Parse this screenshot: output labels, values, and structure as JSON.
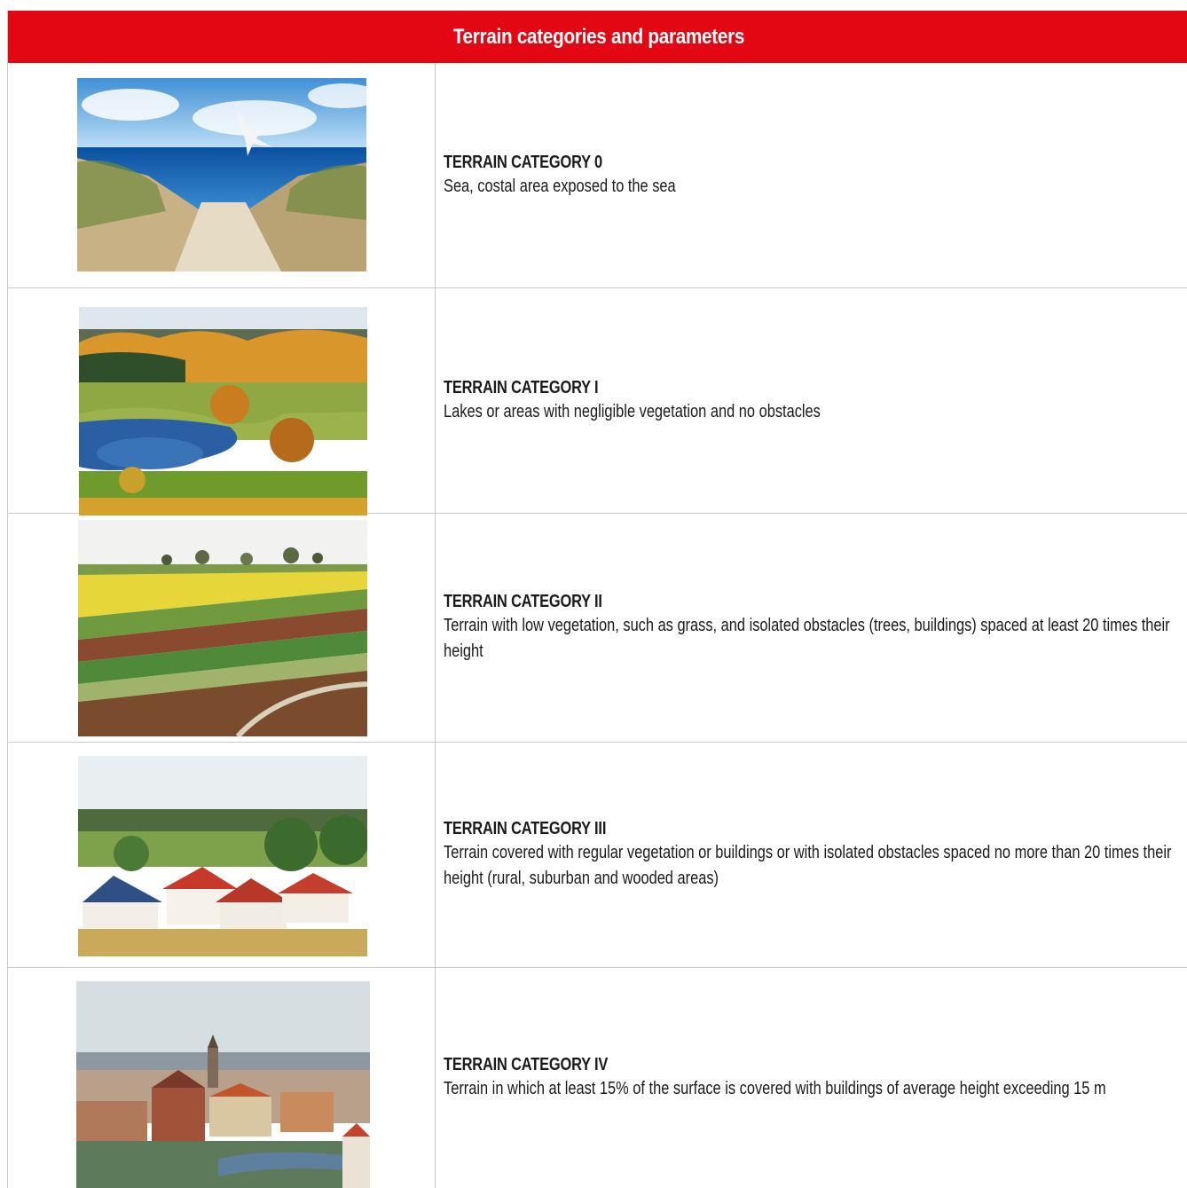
{
  "header": {
    "title": "Terrain categories and parameters"
  },
  "rows": [
    {
      "title": "TERRAIN CATEGORY 0",
      "description": "Sea, costal area exposed to the sea",
      "image": "sea-beach-photo"
    },
    {
      "title": "TERRAIN CATEGORY I",
      "description": "Lakes or areas with negligible vegetation and no obstacles",
      "image": "lake-autumn-photo"
    },
    {
      "title": "TERRAIN CATEGORY II",
      "description": "Terrain with low vegetation, such as grass, and isolated obstacles (trees, buildings) spaced at least 20 times their height",
      "image": "farmland-fields-photo"
    },
    {
      "title": "TERRAIN CATEGORY III",
      "description": "Terrain covered with regular vegetation or buildings or with isolated obstacles spaced no more than 20 times their height (rural, suburban and wooded areas)",
      "image": "suburban-houses-photo"
    },
    {
      "title": "TERRAIN CATEGORY IV",
      "description": "Terrain in which at least 15% of the surface is covered with buildings of average height exceeding 15 m",
      "image": "city-skyline-photo"
    }
  ],
  "colors": {
    "header_bg": "#e30613",
    "header_text": "#ffffff",
    "border": "#c9c9c9"
  }
}
